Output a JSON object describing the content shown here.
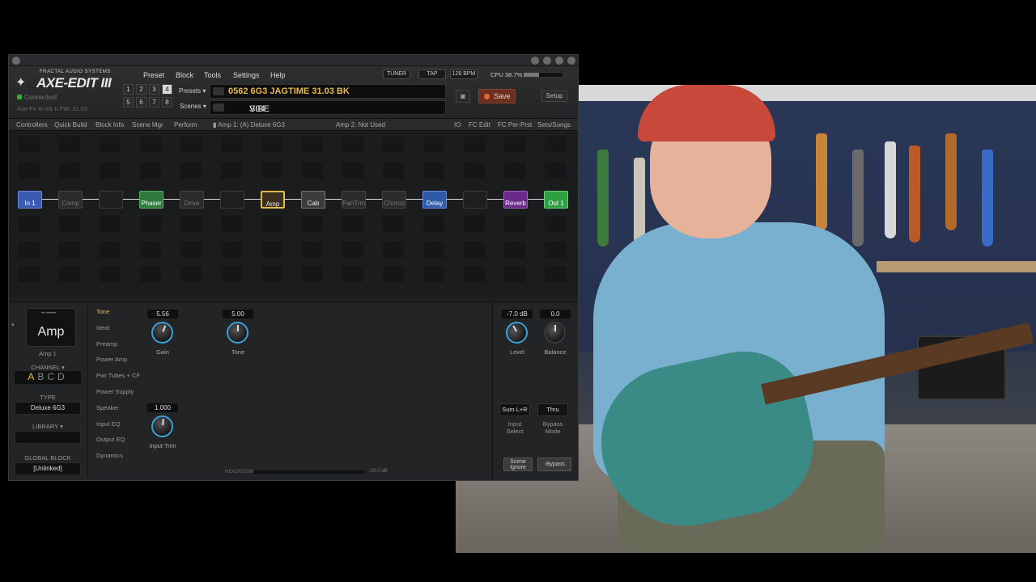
{
  "app": {
    "logo_sub": "FRACTAL AUDIO SYSTEMS",
    "logo_main": "AXE-EDIT III",
    "menu": [
      "Preset",
      "Block",
      "Tools",
      "Settings",
      "Help"
    ],
    "tuner_label": "TUNER",
    "tap_label": "TAP",
    "bpm": "128 BPM",
    "cpu": "CPU 38.7%",
    "cpu_fraction": 0.387,
    "connected": "Connected!",
    "firmware": "Axe-Fx III mk II FW: 31.03",
    "preset_buttons": [
      "1",
      "2",
      "3",
      "4",
      "5",
      "6",
      "7",
      "8"
    ],
    "active_preset_button": "4",
    "presets_label": "Presets",
    "scenes_label": "Scenes",
    "preset_name": "0562  6G3 JAGTIME 31.03 BK",
    "scene_number": "S04",
    "scene_name": "VIBE",
    "save_label": "Save",
    "setup_label": "Setup"
  },
  "toolbar": {
    "controllers": "Controllers",
    "quick_build": "Quick Build",
    "block_info": "Block Info",
    "scene_mgr": "Scene Mgr",
    "perform": "Perform",
    "amp1": "Amp 1: (A) Deluxe 6G3",
    "amp2": "Amp 2: Not Used",
    "io": "IO",
    "fc_edit": "FC Edit",
    "fc_per_prst": "FC Per-Prst",
    "sets_songs": "Sets/Songs"
  },
  "grid": {
    "blocks": [
      {
        "label": "In 1",
        "style": "in"
      },
      {
        "label": "Comp",
        "style": "ghost"
      },
      {
        "label": "",
        "style": "empty"
      },
      {
        "label": "Phaser",
        "style": "green"
      },
      {
        "label": "Drive",
        "style": "ghost"
      },
      {
        "label": "",
        "style": "empty"
      },
      {
        "label": "Amp",
        "style": "amp"
      },
      {
        "label": "Cab",
        "style": "cab"
      },
      {
        "label": "PanTrm",
        "style": "ghost"
      },
      {
        "label": "Chorus",
        "style": "ghost"
      },
      {
        "label": "Delay",
        "style": "delay"
      },
      {
        "label": "",
        "style": "empty"
      },
      {
        "label": "Reverb",
        "style": "reverb"
      },
      {
        "label": "Out 1",
        "style": "out"
      }
    ]
  },
  "editor": {
    "block_title": "Amp",
    "block_instance": "Amp 1",
    "channel_label": "CHANNEL",
    "channels": "ABCD",
    "type_label": "TYPE",
    "type_value": "Deluxe 6G3",
    "library_label": "LIBRARY",
    "global_label": "GLOBAL BLOCK",
    "global_value": "[Unlinked]",
    "pages": [
      "Tone",
      "Ideal",
      "Preamp",
      "Power Amp",
      "Pwr Tubes + CF",
      "Power Supply",
      "Speaker",
      "Input EQ",
      "Output EQ",
      "Dynamics"
    ],
    "active_page": "Tone",
    "knobs": [
      {
        "label": "Gain",
        "value": "5.56"
      },
      {
        "label": "Tone",
        "value": "5.00"
      },
      {
        "label": "Input Trim",
        "value": "1.000"
      }
    ],
    "right_knobs": [
      {
        "label": "Level",
        "value": "-7.0 dB"
      },
      {
        "label": "Balance",
        "value": "0.0"
      }
    ],
    "input_select_value": "Sum L+R",
    "input_select_label": "Input Select",
    "bypass_mode_value": "Thru",
    "bypass_mode_label": "Bypass Mode",
    "scene_ignore": "Scene Ignore",
    "bypass": "Bypass",
    "headroom_label": "HEADROOM",
    "headroom_value": "-20.0 dB"
  },
  "colors": {
    "accent": "#e8b94a",
    "knob_ring": "#3aa0d8",
    "save": "#6a2f1f"
  }
}
